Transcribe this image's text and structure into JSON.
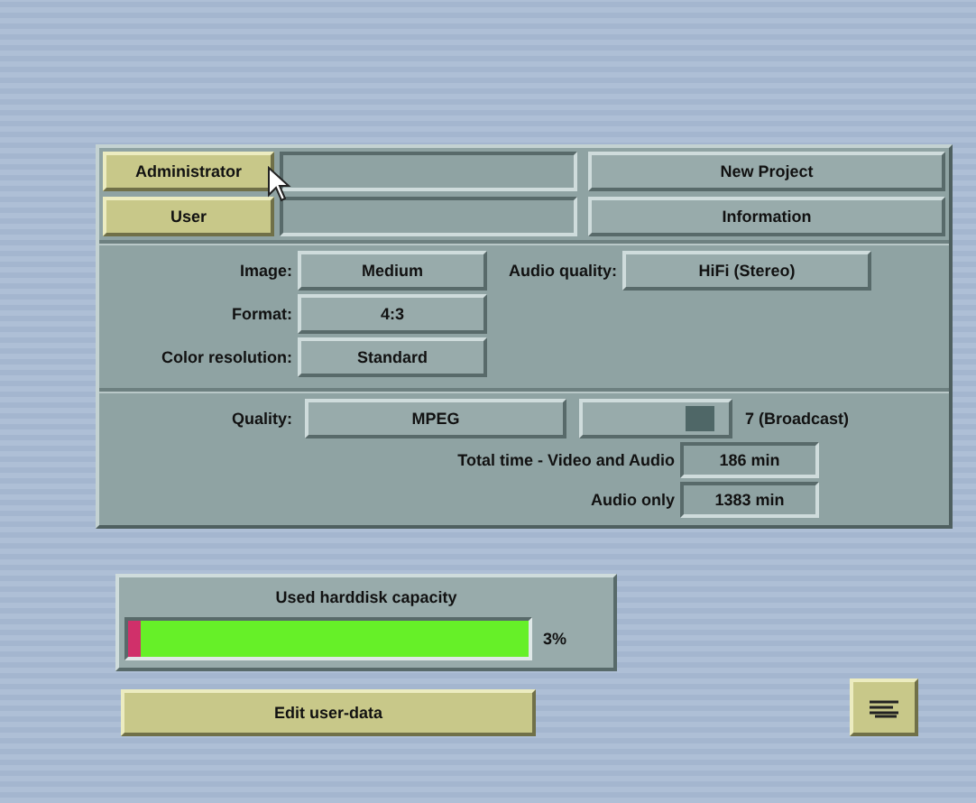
{
  "user_buttons": [
    {
      "label": "Administrator"
    },
    {
      "label": "User"
    }
  ],
  "actions": [
    "New Project",
    "Information"
  ],
  "settings": [
    {
      "label": "Image:",
      "value": "Medium"
    },
    {
      "label": "Format:",
      "value": "4:3"
    },
    {
      "label": "Color resolution:",
      "value": "Standard"
    }
  ],
  "audio_quality": {
    "label": "Audio quality:",
    "value": "HiFi (Stereo)"
  },
  "quality": {
    "label": "Quality:",
    "value": "MPEG",
    "level": 0.8,
    "reading": "7 (Broadcast)"
  },
  "times": [
    {
      "label": "Total time - Video and Audio",
      "value": "186 min"
    },
    {
      "label": "Audio only",
      "value": "1383 min"
    }
  ],
  "harddisk": {
    "title": "Used harddisk capacity",
    "level": 0.03,
    "reading": "3%"
  },
  "edit_button": "Edit user-data"
}
